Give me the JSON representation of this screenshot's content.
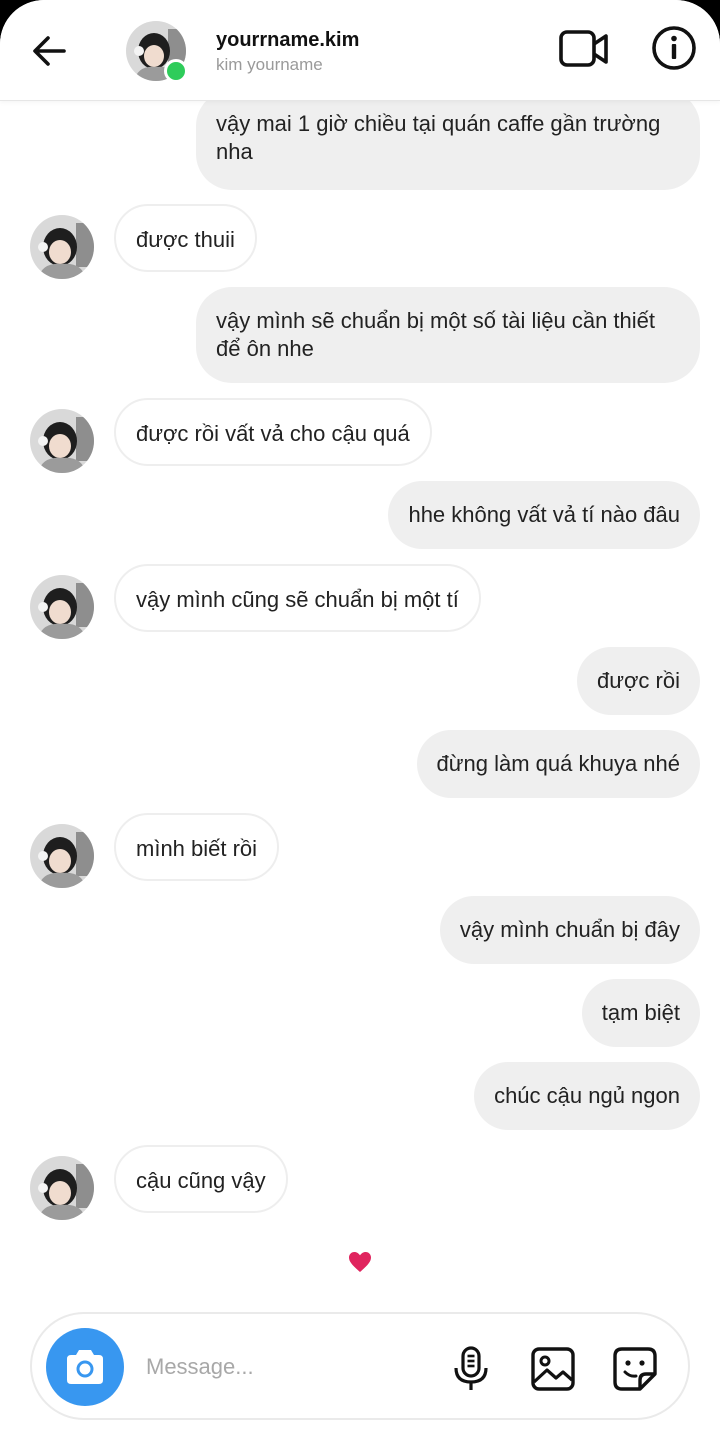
{
  "header": {
    "username": "yourrname.kim",
    "subtitle": "kim yourname"
  },
  "messages": [
    {
      "side": "out",
      "text": "vậy mai 1 giờ chiều tại quán caffe gần trường nha"
    },
    {
      "side": "in",
      "text": "được thuii"
    },
    {
      "side": "out",
      "text": "vậy mình sẽ chuẩn bị một số tài liệu cần thiết để ôn nhe"
    },
    {
      "side": "in",
      "text": "được rồi vất vả cho cậu quá"
    },
    {
      "side": "out",
      "text": "hhe không vất vả tí nào đâu"
    },
    {
      "side": "in",
      "text": "vậy mình cũng sẽ chuẩn bị một tí"
    },
    {
      "side": "out",
      "text": "được rồi"
    },
    {
      "side": "out",
      "text": "đừng làm quá khuya nhé"
    },
    {
      "side": "in",
      "text": "mình biết rồi"
    },
    {
      "side": "out",
      "text": "vậy mình chuẩn bị đây"
    },
    {
      "side": "out",
      "text": "tạm biệt"
    },
    {
      "side": "out",
      "text": "chúc cậu ngủ ngon"
    },
    {
      "side": "in",
      "text": "cậu cũng vậy"
    }
  ],
  "reaction": {
    "icon": "heart-icon",
    "color": "#e0245e"
  },
  "composer": {
    "placeholder": "Message..."
  },
  "colors": {
    "accent": "#3897f0",
    "online": "#2ecc5a",
    "outgoing_bubble": "#efefef"
  }
}
